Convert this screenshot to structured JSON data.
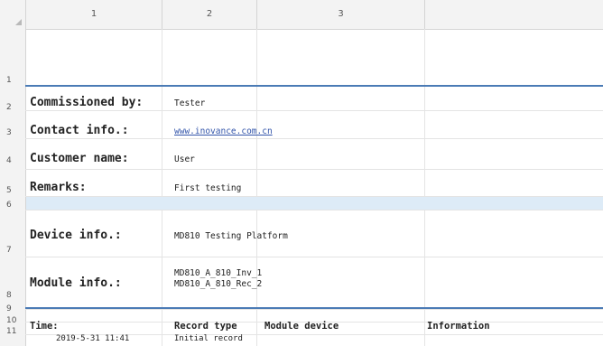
{
  "columns": [
    "1",
    "2",
    "3"
  ],
  "rows": [
    "1",
    "2",
    "3",
    "4",
    "5",
    "6",
    "7",
    "8",
    "9",
    "10",
    "11"
  ],
  "info": {
    "commissioned_label": "Commissioned by:",
    "commissioned_value": "Tester",
    "contact_label": "Contact info.:",
    "contact_value": "www.inovance.com.cn",
    "customer_label": "Customer name:",
    "customer_value": "User",
    "remarks_label": "Remarks:",
    "remarks_value": "First testing",
    "device_label": "Device info.:",
    "device_value": "MD810 Testing Platform",
    "module_label": "Module info.:",
    "module_value_1": "MD810_A_810_Inv_1",
    "module_value_2": "MD810_A_810_Rec_2"
  },
  "table": {
    "headers": [
      "Time:",
      "Record type",
      "Module device",
      "Information"
    ],
    "rows": [
      {
        "time": "2019-5-31 11:41",
        "type": "Initial record"
      }
    ]
  }
}
